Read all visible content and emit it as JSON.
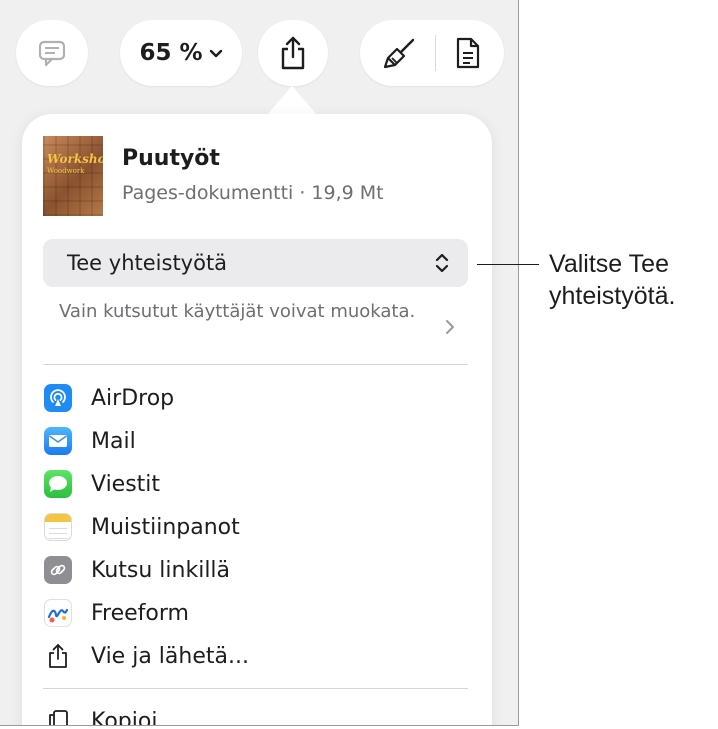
{
  "toolbar": {
    "zoom_label": "65 %",
    "icons": [
      "comment-icon",
      "chevron-down-icon",
      "share-icon",
      "paintbrush-icon",
      "document-icon"
    ]
  },
  "document": {
    "title": "Puutyöt",
    "subtitle": "Pages-dokumentti · 19,9 Mt",
    "thumbnail_text_1": "Workshop",
    "thumbnail_text_2": "Woodwork"
  },
  "collaboration": {
    "selected": "Tee yhteistyötä",
    "permission_text": "Vain kutsutut käyttäjät voivat muokata."
  },
  "share_menu": [
    {
      "label": "AirDrop",
      "icon": "airdrop-icon"
    },
    {
      "label": "Mail",
      "icon": "mail-icon"
    },
    {
      "label": "Viestit",
      "icon": "messages-icon"
    },
    {
      "label": "Muistiinpanot",
      "icon": "notes-icon"
    },
    {
      "label": "Kutsu linkillä",
      "icon": "link-icon"
    },
    {
      "label": "Freeform",
      "icon": "freeform-icon"
    },
    {
      "label": "Vie ja lähetä...",
      "icon": "export-icon"
    }
  ],
  "more_menu": [
    {
      "label": "Kopioi",
      "icon": "copy-icon"
    }
  ],
  "callout": {
    "text": "Valitse Tee yhteistyötä."
  },
  "colors": {
    "background": "#f0f0f0",
    "popover": "#ffffff",
    "select": "#ebebed",
    "secondary_text": "#6e6e73"
  }
}
